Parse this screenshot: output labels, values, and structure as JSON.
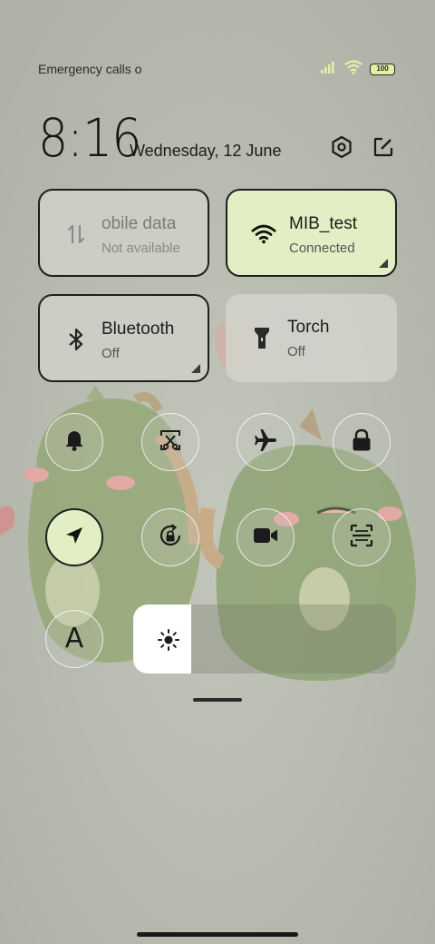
{
  "status_bar": {
    "carrier_text": "Emergency calls o",
    "battery_level": "100",
    "icons": [
      "signal-icon",
      "wifi-icon",
      "battery-icon"
    ]
  },
  "header": {
    "time": "8:16",
    "date": "Wednesday, 12 June",
    "settings_icon": "settings-hexagon-icon",
    "edit_icon": "edit-icon"
  },
  "tiles": {
    "mobile_data": {
      "label": "Mobile data",
      "visible_label": "obile data",
      "sub": "Not available",
      "icon": "mobile-data-icon",
      "state": "disabled"
    },
    "wifi": {
      "label": "MIB_test",
      "sub": "Connected",
      "icon": "wifi-icon",
      "state": "on"
    },
    "bluetooth": {
      "label": "Bluetooth",
      "sub": "Off",
      "icon": "bluetooth-icon",
      "state": "off"
    },
    "torch": {
      "label": "Torch",
      "sub": "Off",
      "icon": "torch-icon",
      "state": "off"
    }
  },
  "round_toggles": [
    {
      "name": "ring-mode",
      "icon": "bell-icon",
      "active": false
    },
    {
      "name": "screenshot",
      "icon": "screenshot-icon",
      "active": false
    },
    {
      "name": "airplane-mode",
      "icon": "airplane-icon",
      "active": false
    },
    {
      "name": "lock-screen",
      "icon": "lock-icon",
      "active": false
    },
    {
      "name": "location",
      "icon": "location-arrow-icon",
      "active": true
    },
    {
      "name": "rotation-lock",
      "icon": "rotation-lock-icon",
      "active": false
    },
    {
      "name": "screen-recorder",
      "icon": "video-camera-icon",
      "active": false
    },
    {
      "name": "scanner",
      "icon": "scan-icon",
      "active": false
    },
    {
      "name": "auto-brightness",
      "icon": "letter-a-icon",
      "active": false
    }
  ],
  "brightness": {
    "level": 0.22,
    "icon": "sun-icon"
  },
  "auto_brightness_glyph": "A",
  "colors": {
    "accent_tile": "#e2efc4",
    "tile_off": "#cdcec7",
    "background": "#b4b7ac"
  }
}
